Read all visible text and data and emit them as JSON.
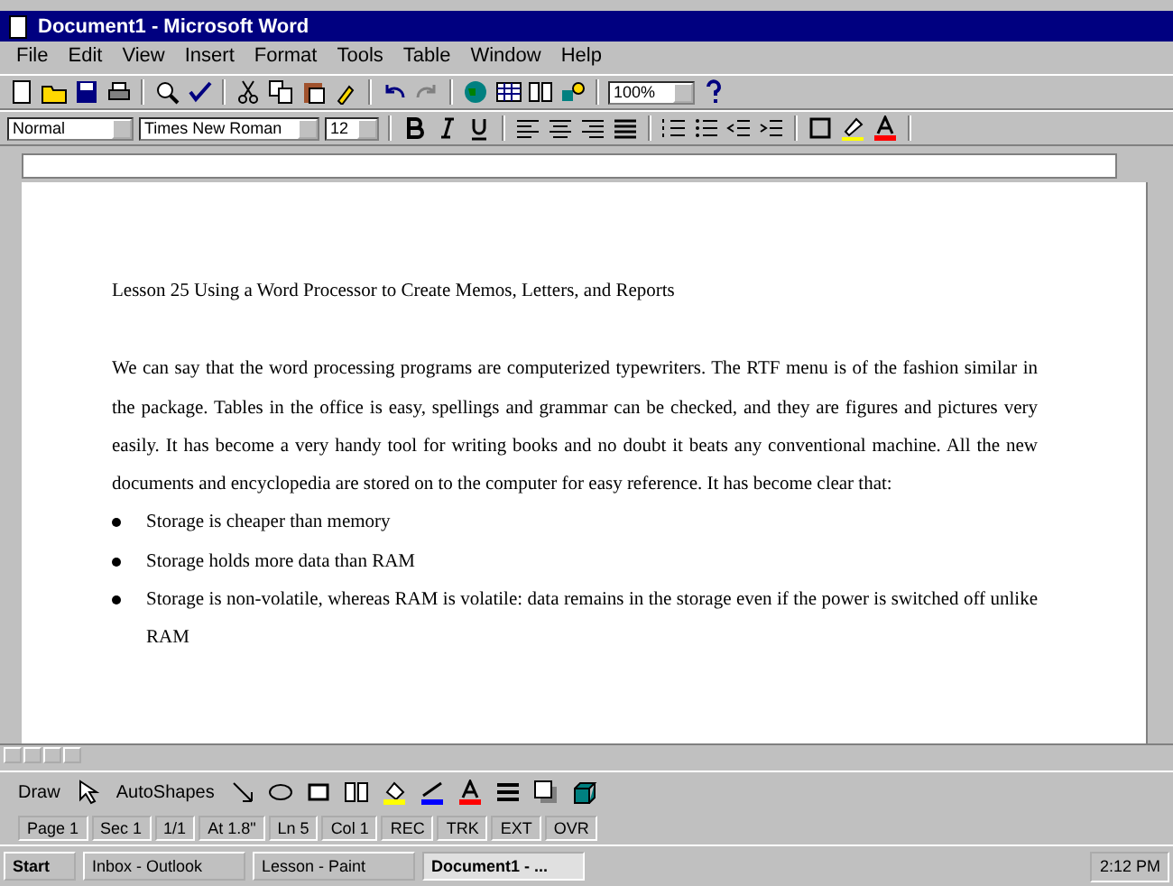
{
  "window": {
    "title": "Document1 - Microsoft Word"
  },
  "menu": [
    "File",
    "Edit",
    "View",
    "Insert",
    "Format",
    "Tools",
    "Table",
    "Window",
    "Help"
  ],
  "formatting": {
    "style": "Normal",
    "font": "Times New Roman",
    "size": "12",
    "zoom": "100%"
  },
  "document": {
    "heading": "Lesson 25 Using a Word Processor to Create Memos, Letters, and Reports",
    "paragraph": "We can say that the word processing programs are computerized typewriters. The RTF menu is of the fashion similar in the package. Tables in the office is easy, spellings and grammar can be checked, and they are figures and pictures very easily. It has become a very handy tool for writing books and no doubt it beats any conventional machine. All the new documents and encyclopedia are stored on to the computer for easy reference. It has become clear that:",
    "bullets": [
      "Storage is cheaper than memory",
      "Storage holds more data than RAM",
      "Storage is non-volatile, whereas RAM is volatile: data remains in the storage even if the power is switched off unlike RAM"
    ]
  },
  "drawing_toolbar": {
    "draw": "Draw",
    "autoshapes": "AutoShapes"
  },
  "status_bar": [
    "Page 1",
    "Sec 1",
    "1/1",
    "At 1.8\"",
    "Ln 5",
    "Col 1",
    "REC",
    "TRK",
    "EXT",
    "OVR"
  ],
  "taskbar": {
    "start": "Start",
    "tasks": [
      {
        "label": "Inbox - Outlook",
        "selected": false
      },
      {
        "label": "Lesson - Paint",
        "selected": false
      },
      {
        "label": "Document1 - ...",
        "selected": true
      }
    ],
    "clock": "2:12 PM"
  }
}
